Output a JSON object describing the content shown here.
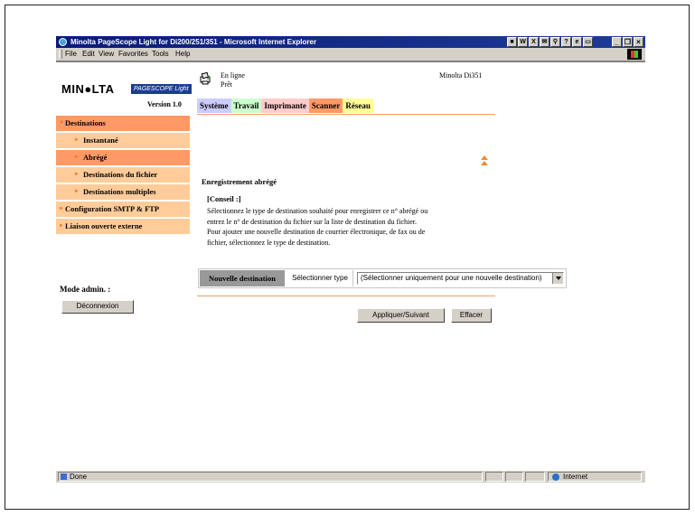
{
  "window": {
    "title": "Minolta PageScope Light for Di200/251/351 - Microsoft Internet Explorer",
    "menu": [
      "File",
      "Edit",
      "View",
      "Favorites",
      "Tools",
      "Help"
    ],
    "status_text": "Done",
    "zone": "Internet"
  },
  "header": {
    "logo": "MIN●LTA",
    "pagescope": "PAGESCOPE Light",
    "version": "Version 1.0",
    "status_line1": "En ligne",
    "status_line2": "Prêt",
    "model": "Minolta Di351"
  },
  "tabs": [
    "Système",
    "Travail",
    "Imprimante",
    "Scanner",
    "Réseau"
  ],
  "active_tab": "Scanner",
  "sidebar": {
    "items": [
      {
        "label": "Destinations",
        "level": "top",
        "active": true,
        "arrow": "▼"
      },
      {
        "label": "Instantané",
        "level": "sub",
        "active": false,
        "arrow": "►"
      },
      {
        "label": "Abrégé",
        "level": "sub",
        "active": true,
        "arrow": "►"
      },
      {
        "label": "Destinations du fichier",
        "level": "sub",
        "active": false,
        "arrow": "►"
      },
      {
        "label": "Destinations multiples",
        "level": "sub",
        "active": false,
        "arrow": "►"
      },
      {
        "label": "Configuration SMTP & FTP",
        "level": "top",
        "active": false,
        "arrow": "►"
      },
      {
        "label": "Liaison ouverte externe",
        "level": "top",
        "active": false,
        "arrow": "►"
      }
    ],
    "admin_label": "Mode admin. :",
    "logout_button": "Déconnexion"
  },
  "main": {
    "section_title": "Enregistrement abrégé",
    "conseil_title": "[Conseil :]",
    "conseil_lines": [
      "Sélectionnez le type de destination souhaité pour enregistrer ce n° abrégé ou",
      "entrez le n° de destination du fichier sur la liste de destination du fichier.",
      "Pour ajouter une nouvelle destination de courrier électronique, de fax ou de",
      "fichier, sélectionnez le type de destination."
    ],
    "new_dest_label": "Nouvelle destination",
    "select_type_label": "Sélectionner type",
    "select_value": "(Sélectionner uniquement pour une nouvelle destination)",
    "apply_button": "Appliquer/Suivant",
    "clear_button": "Effacer"
  },
  "colors": {
    "nav_active": "#ff9966",
    "nav_inactive": "#ffcc99",
    "tab_systeme": "#ccccff",
    "tab_travail": "#ccffcc",
    "tab_imprimante": "#ffcccc",
    "tab_scanner": "#ff9966",
    "tab_reseau": "#ffff99",
    "titlebar": "#0a1a7a"
  }
}
